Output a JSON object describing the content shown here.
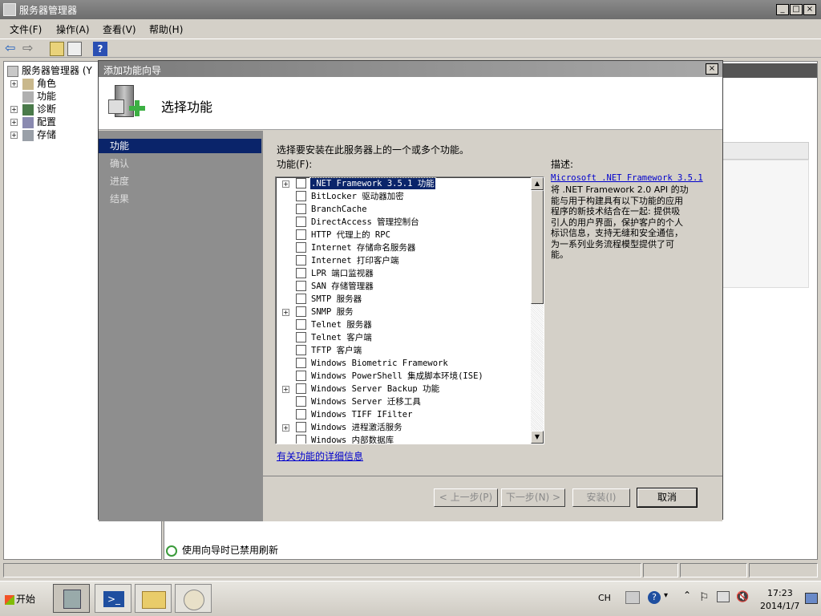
{
  "main_window": {
    "title": "服务器管理器",
    "menu": [
      "文件(F)",
      "操作(A)",
      "查看(V)",
      "帮助(H)"
    ],
    "tree": {
      "root": "服务器管理器 (Y",
      "items": [
        "角色",
        "功能",
        "诊断",
        "配置",
        "存储"
      ]
    },
    "status_text": "使用向导时已禁用刷新"
  },
  "dialog": {
    "title": "添加功能向导",
    "heading": "选择功能",
    "nav": [
      "功能",
      "确认",
      "进度",
      "结果"
    ],
    "instruction": "选择要安装在此服务器上的一个或多个功能。",
    "list_label": "功能(F):",
    "features": [
      {
        "label": ".NET Framework 3.5.1 功能",
        "expandable": true,
        "selected": true
      },
      {
        "label": "BitLocker 驱动器加密",
        "expandable": false
      },
      {
        "label": "BranchCache",
        "expandable": false
      },
      {
        "label": "DirectAccess 管理控制台",
        "expandable": false
      },
      {
        "label": "HTTP 代理上的 RPC",
        "expandable": false
      },
      {
        "label": "Internet 存储命名服务器",
        "expandable": false
      },
      {
        "label": "Internet 打印客户端",
        "expandable": false
      },
      {
        "label": "LPR 端口监视器",
        "expandable": false
      },
      {
        "label": "SAN 存储管理器",
        "expandable": false
      },
      {
        "label": "SMTP 服务器",
        "expandable": false
      },
      {
        "label": "SNMP 服务",
        "expandable": true
      },
      {
        "label": "Telnet 服务器",
        "expandable": false
      },
      {
        "label": "Telnet 客户端",
        "expandable": false
      },
      {
        "label": "TFTP 客户端",
        "expandable": false
      },
      {
        "label": "Windows Biometric Framework",
        "expandable": false
      },
      {
        "label": "Windows PowerShell 集成脚本环境(ISE)",
        "expandable": false
      },
      {
        "label": "Windows Server Backup 功能",
        "expandable": true
      },
      {
        "label": "Windows Server 迁移工具",
        "expandable": false
      },
      {
        "label": "Windows TIFF IFilter",
        "expandable": false
      },
      {
        "label": "Windows 进程激活服务",
        "expandable": true
      },
      {
        "label": "Windows 内部数据库",
        "expandable": false
      }
    ],
    "more_info_link": "有关功能的详细信息",
    "description_label": "描述:",
    "description_link": "Microsoft .NET Framework 3.5.1",
    "description_lines": [
      "将 .NET Framework 2.0 API 的功",
      "能与用于构建具有以下功能的应用",
      "程序的新技术结合在一起: 提供吸",
      "引人的用户界面，保护客户的个人",
      "标识信息，支持无缝和安全通信，",
      "为一系列业务流程模型提供了可",
      "能。"
    ],
    "buttons": {
      "prev": "< 上一步(P)",
      "next": "下一步(N) >",
      "install": "安装(I)",
      "cancel": "取消"
    }
  },
  "taskbar": {
    "start": "开始",
    "lang": "CH",
    "time": "17:23",
    "date": "2014/1/7"
  }
}
